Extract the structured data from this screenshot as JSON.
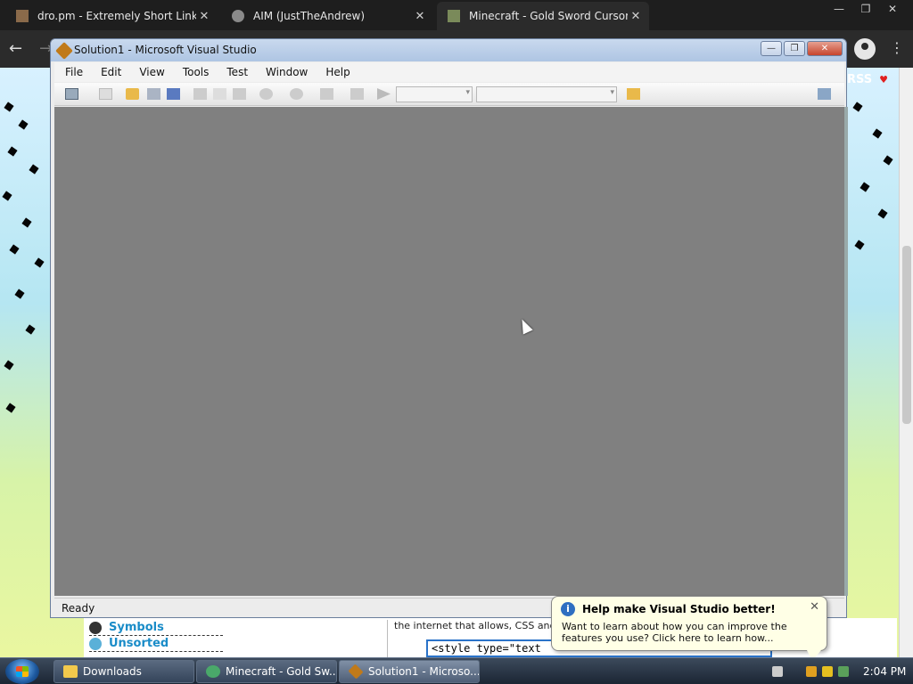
{
  "browser": {
    "tabs": [
      {
        "title": "dro.pm - Extremely Short Links",
        "close": "✕"
      },
      {
        "title": "AIM (JustTheAndrew)",
        "close": "✕"
      },
      {
        "title": "Minecraft - Gold Sword Cursor",
        "close": "✕"
      }
    ],
    "window_controls": [
      "—",
      "❐",
      "✕"
    ],
    "nav": {
      "back": "←",
      "forward": "→",
      "menu": "⋮"
    }
  },
  "page": {
    "rss_label": "RSS",
    "heart": "♥",
    "sidebar_links": [
      "Symbols",
      "Unsorted"
    ],
    "description": "the internet that allows, CSS and HT",
    "code_snippet": "<style type=\"text"
  },
  "vs": {
    "title": "Solution1 - Microsoft Visual Studio",
    "menu": [
      "File",
      "Edit",
      "View",
      "Tools",
      "Test",
      "Window",
      "Help"
    ],
    "status": "Ready",
    "window_controls": {
      "minimize": "—",
      "restore": "❐",
      "close": "✕"
    }
  },
  "balloon": {
    "title": "Help make Visual Studio better!",
    "text": "Want to learn about how you can improve the features you use? Click here to learn how...",
    "close": "✕",
    "info": "i"
  },
  "taskbar": {
    "items": [
      {
        "label": "Downloads",
        "icon": "folder-icon",
        "color": "#f2c94c"
      },
      {
        "label": "Minecraft - Gold Sw...",
        "icon": "chrome-icon",
        "color": "#4aa86a"
      },
      {
        "label": "Solution1 - Microso...",
        "icon": "visual-studio-icon",
        "color": "#c07a1a"
      }
    ],
    "clock": "2:04 PM"
  }
}
